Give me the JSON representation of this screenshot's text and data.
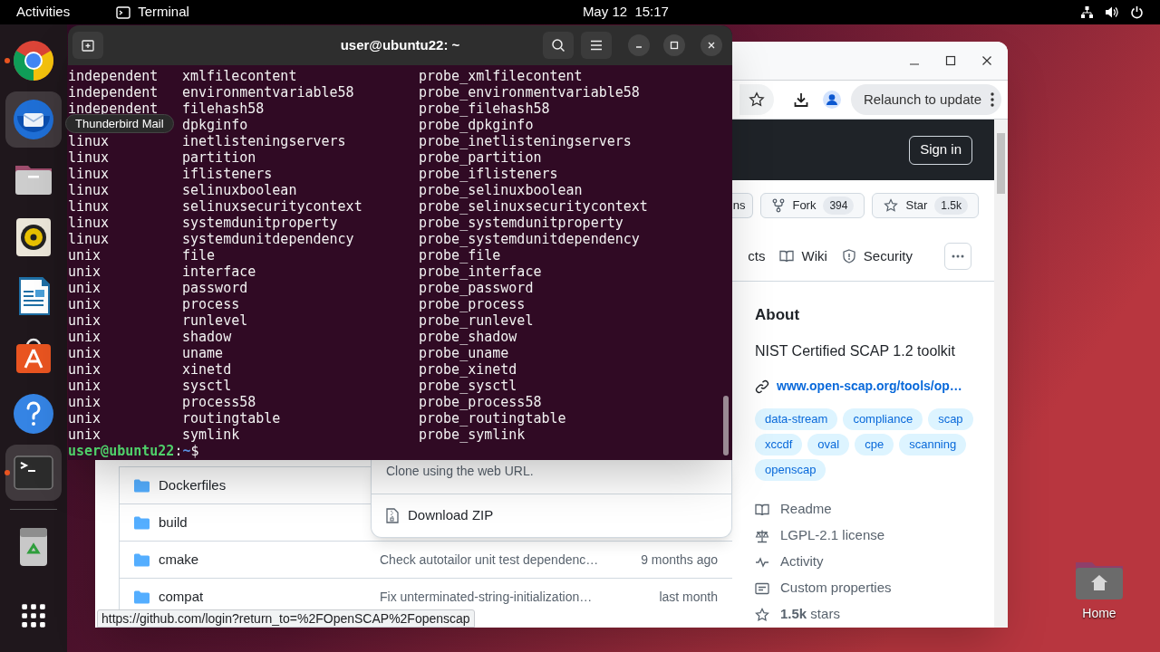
{
  "top_bar": {
    "activities": "Activities",
    "app": "Terminal",
    "clock": "May 12  15:17"
  },
  "dock": {
    "items": [
      {
        "kind": "browser",
        "running": true,
        "highlighted": false
      },
      {
        "kind": "mail",
        "running": false,
        "highlighted": true
      },
      {
        "kind": "files",
        "running": false,
        "highlighted": false
      },
      {
        "kind": "music",
        "running": false,
        "highlighted": false
      },
      {
        "kind": "writer",
        "running": false,
        "highlighted": false
      },
      {
        "kind": "store",
        "running": false,
        "highlighted": false
      },
      {
        "kind": "help",
        "running": false,
        "highlighted": false
      },
      {
        "kind": "terminal",
        "running": true,
        "highlighted": true
      },
      {
        "kind": "trash",
        "running": false,
        "highlighted": false
      },
      {
        "kind": "apps",
        "running": false,
        "highlighted": false
      }
    ]
  },
  "tooltip": "Thunderbird Mail",
  "terminal": {
    "title": "user@ubuntu22: ~",
    "rows": [
      {
        "column_1": "independent",
        "column_2": "xmlfilecontent",
        "column_3": "probe_xmlfilecontent"
      },
      {
        "column_1": "independent",
        "column_2": "environmentvariable58",
        "column_3": "probe_environmentvariable58"
      },
      {
        "column_1": "independent",
        "column_2": "filehash58",
        "column_3": "probe_filehash58"
      },
      {
        "column_2": "dpkginfo",
        "column_3": "probe_dpkginfo"
      },
      {
        "column_1": "linux",
        "column_2": "inetlisteningservers",
        "column_3": "probe_inetlisteningservers"
      },
      {
        "column_1": "linux",
        "column_2": "partition",
        "column_3": "probe_partition"
      },
      {
        "column_1": "linux",
        "column_2": "iflisteners",
        "column_3": "probe_iflisteners"
      },
      {
        "column_1": "linux",
        "column_2": "selinuxboolean",
        "column_3": "probe_selinuxboolean"
      },
      {
        "column_1": "linux",
        "column_2": "selinuxsecuritycontext",
        "column_3": "probe_selinuxsecuritycontext"
      },
      {
        "column_1": "linux",
        "column_2": "systemdunitproperty",
        "column_3": "probe_systemdunitproperty"
      },
      {
        "column_1": "linux",
        "column_2": "systemdunitdependency",
        "column_3": "probe_systemdunitdependency"
      },
      {
        "column_1": "unix",
        "column_2": "file",
        "column_3": "probe_file"
      },
      {
        "column_1": "unix",
        "column_2": "interface",
        "column_3": "probe_interface"
      },
      {
        "column_1": "unix",
        "column_2": "password",
        "column_3": "probe_password"
      },
      {
        "column_1": "unix",
        "column_2": "process",
        "column_3": "probe_process"
      },
      {
        "column_1": "unix",
        "column_2": "runlevel",
        "column_3": "probe_runlevel"
      },
      {
        "column_1": "unix",
        "column_2": "shadow",
        "column_3": "probe_shadow"
      },
      {
        "column_1": "unix",
        "column_2": "uname",
        "column_3": "probe_uname"
      },
      {
        "column_1": "unix",
        "column_2": "xinetd",
        "column_3": "probe_xinetd"
      },
      {
        "column_1": "unix",
        "column_2": "sysctl",
        "column_3": "probe_sysctl"
      },
      {
        "column_1": "unix",
        "column_2": "process58",
        "column_3": "probe_process58"
      },
      {
        "column_1": "unix",
        "column_2": "routingtable",
        "column_3": "probe_routingtable"
      },
      {
        "column_1": "unix",
        "column_2": "symlink",
        "column_3": "probe_symlink"
      }
    ],
    "prompt": {
      "user_host": "user@ubuntu22",
      "separator": ":",
      "path": "~",
      "symbol": "$"
    }
  },
  "browser": {
    "update_button": "Relaunch to update",
    "sign_in": "Sign in",
    "repo_actions": [
      {
        "kind": "notifications",
        "label": "ns"
      },
      {
        "kind": "fork",
        "label": "Fork",
        "count": "394"
      },
      {
        "kind": "star",
        "label": "Star",
        "count": "1.5k"
      }
    ],
    "repo_tabs": [
      {
        "kind": "projects",
        "label": "cts"
      },
      {
        "kind": "wiki",
        "label": "Wiki"
      },
      {
        "kind": "security",
        "label": "Security"
      }
    ],
    "files": [
      {
        "name": "Dockerfiles"
      },
      {
        "name": "build"
      },
      {
        "name": "cmake",
        "message": "Check autotailor unit test dependenc…",
        "date": "9 months ago"
      },
      {
        "name": "compat",
        "message": "Fix unterminated-string-initialization…",
        "date": "last month"
      }
    ],
    "code_menu": {
      "clone_hint": "Clone using the web URL.",
      "download": "Download ZIP"
    },
    "about": {
      "heading": "About",
      "description": "NIST Certified SCAP 1.2 toolkit",
      "link": "www.open-scap.org/tools/op…",
      "topics": [
        "data-stream",
        "compliance",
        "scap",
        "xccdf",
        "oval",
        "cpe",
        "scanning",
        "openscap"
      ],
      "links": [
        {
          "kind": "readme",
          "label": "Readme"
        },
        {
          "kind": "license",
          "label": "LGPL-2.1 license"
        },
        {
          "kind": "activity",
          "label": "Activity"
        },
        {
          "kind": "properties",
          "label": "Custom properties"
        },
        {
          "kind": "stars",
          "label": "**1.5k** stars"
        }
      ]
    },
    "status_url": "https://github.com/login?return_to=%2FOpenSCAP%2Fopenscap"
  },
  "desktop_icons": [
    {
      "label": "Home"
    }
  ]
}
